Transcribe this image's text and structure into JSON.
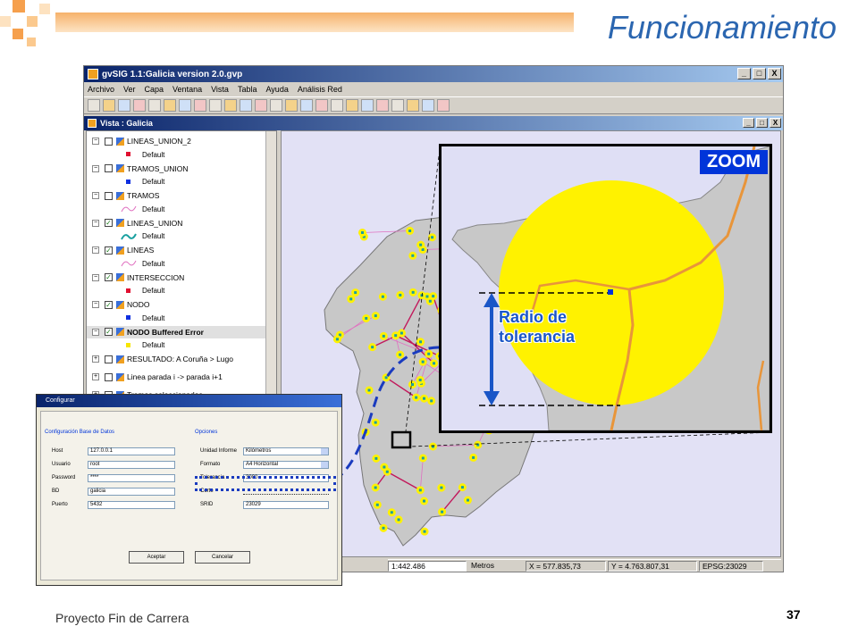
{
  "slide": {
    "title": "Funcionamiento",
    "footer": "Proyecto Fin de Carrera",
    "page_number": "37"
  },
  "window": {
    "title": "gvSIG 1.1:Galicia version 2.0.gvp",
    "menu": [
      "Archivo",
      "Ver",
      "Capa",
      "Ventana",
      "Vista",
      "Tabla",
      "Ayuda",
      "Análisis Red"
    ],
    "controls": [
      "_",
      "□",
      "X"
    ]
  },
  "view": {
    "title": "Vista : Galicia",
    "layers": [
      {
        "name": "LINEAS_UNION_2",
        "checked": false,
        "legend": "Default",
        "symbol": "red-dot"
      },
      {
        "name": "TRAMOS_UNION",
        "checked": false,
        "legend": "Default",
        "symbol": "blue-dot"
      },
      {
        "name": "TRAMOS",
        "checked": false,
        "legend": "Default",
        "symbol": "pink-line"
      },
      {
        "name": "LINEAS_UNION",
        "checked": true,
        "legend": "Default",
        "symbol": "teal-line"
      },
      {
        "name": "LINEAS",
        "checked": true,
        "legend": "Default",
        "symbol": "pink-line"
      },
      {
        "name": "INTERSECCION",
        "checked": true,
        "legend": "Default",
        "symbol": "red-dot"
      },
      {
        "name": "NODO",
        "checked": true,
        "legend": "Default",
        "symbol": "blue-dot"
      },
      {
        "name": "NODO Buffered Error",
        "checked": true,
        "legend": "Default",
        "symbol": "yellow-dot",
        "bold": true
      },
      {
        "name": "RESULTADO: A Coruña > Lugo",
        "checked": false
      },
      {
        "name": "Linea parada i -> parada i+1",
        "checked": false
      },
      {
        "name": "Tramos seleccionados",
        "checked": false
      }
    ],
    "expander_open": "−",
    "expander_closed": "+"
  },
  "statusbar": {
    "scale_prefix": "1:",
    "scale": "1:442.486",
    "units": "Metros",
    "x": "X = 577.835,73",
    "y": "Y = 4.763.807,31",
    "epsg": "EPSG:23029"
  },
  "zoom": {
    "badge": "ZOOM",
    "label": "Radio de\ntolerancia"
  },
  "dialog": {
    "title": "Configurar",
    "db_group": "Configuración Base de Datos",
    "options_group": "Opciones",
    "db_fields": [
      {
        "label": "Host",
        "value": "127.0.0.1"
      },
      {
        "label": "Usuario",
        "value": "root"
      },
      {
        "label": "Password",
        "value": "****"
      },
      {
        "label": "BD",
        "value": "galicia"
      },
      {
        "label": "Puerto",
        "value": "5432"
      }
    ],
    "option_fields": [
      {
        "label": "Unidad Informe",
        "value": "Kilómetros",
        "type": "select"
      },
      {
        "label": "Formato",
        "value": "A4 Horizontal",
        "type": "select"
      },
      {
        "label": "Tolerancia",
        "value": "3000",
        "type": "text"
      },
      {
        "label": "Corte",
        "value": "",
        "type": "slider"
      },
      {
        "label": "SRID",
        "value": "23029",
        "type": "text"
      }
    ],
    "accept": "Aceptar",
    "cancel": "Cancelar"
  },
  "colors": {
    "accent": "#2b66b0",
    "zoom_badge": "#0035d9",
    "buffer": "#fff200",
    "land": "#c8c8c8",
    "sea": "#e2e1f5",
    "roads": "#c2185b",
    "highlight_dash": "#1a3bbf"
  }
}
